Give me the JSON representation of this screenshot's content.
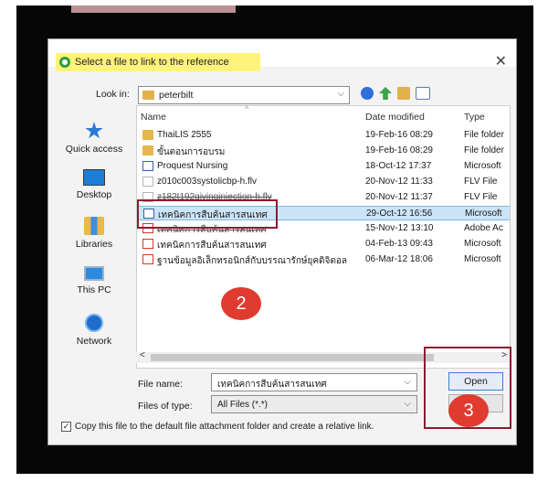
{
  "dialog": {
    "title": "Select a file to link to the reference",
    "close_glyph": "✕"
  },
  "toolbar": {
    "look_in_label": "Look in:",
    "look_in_value": "peterbilt",
    "chevron": "⌵",
    "icons": [
      "back-icon",
      "up-folder-icon",
      "new-folder-icon",
      "view-menu-icon"
    ]
  },
  "places": [
    {
      "label": "Quick access",
      "icon": "star-icon"
    },
    {
      "label": "Desktop",
      "icon": "desktop-icon"
    },
    {
      "label": "Libraries",
      "icon": "libraries-icon"
    },
    {
      "label": "This PC",
      "icon": "computer-icon"
    },
    {
      "label": "Network",
      "icon": "network-icon"
    }
  ],
  "columns": {
    "name": "Name",
    "date": "Date modified",
    "type": "Type"
  },
  "files": [
    {
      "name": "ThaiLIS 2555",
      "date": "19-Feb-16 08:29",
      "type": "File folder",
      "kind": "folder"
    },
    {
      "name": "ขั้นตอนการอบรม",
      "date": "19-Feb-16 08:29",
      "type": "File folder",
      "kind": "folder"
    },
    {
      "name": "Proquest Nursing",
      "date": "18-Oct-12 17:37",
      "type": "Microsoft",
      "kind": "doc"
    },
    {
      "name": "z010c003systolicbp-h.flv",
      "date": "20-Nov-12 11:33",
      "type": "FLV File",
      "kind": "flv"
    },
    {
      "name": "z182t192givinginjection-h.flv",
      "date": "20-Nov-12 11:37",
      "type": "FLV File",
      "kind": "flv"
    },
    {
      "name": "เทคนิคการสืบค้นสารสนเทศ",
      "date": "29-Oct-12 16:56",
      "type": "Microsoft",
      "kind": "doc",
      "selected": true
    },
    {
      "name": "เทคนิคการสืบค้นสารสนเทศ",
      "date": "15-Nov-12 13:10",
      "type": "Adobe Ac",
      "kind": "pdf"
    },
    {
      "name": "เทคนิคการสืบค้นสารสนเทศ",
      "date": "04-Feb-13 09:43",
      "type": "Microsoft",
      "kind": "pdf"
    },
    {
      "name": "ฐานข้อมูลอิเล็กทรอนิกส์กับบรรณารักษ์ยุคดิจิตอล",
      "date": "06-Mar-12 18:06",
      "type": "Microsoft",
      "kind": "pdf"
    }
  ],
  "form": {
    "file_name_label": "File name:",
    "file_name_value": "เทคนิคการสืบค้นสารสนเทศ",
    "file_type_label": "Files of type:",
    "file_type_value": "All Files (*.*)",
    "open_label": "Open",
    "copy_checkbox_label": "Copy this file to the default file attachment folder and create a relative link.",
    "copy_checked": true,
    "check_glyph": "✓"
  },
  "scrollbar": {
    "left_arrow": "<",
    "right_arrow": ">"
  },
  "annotations": {
    "step2": "2",
    "step3": "3",
    "color": "#e03b2f"
  }
}
